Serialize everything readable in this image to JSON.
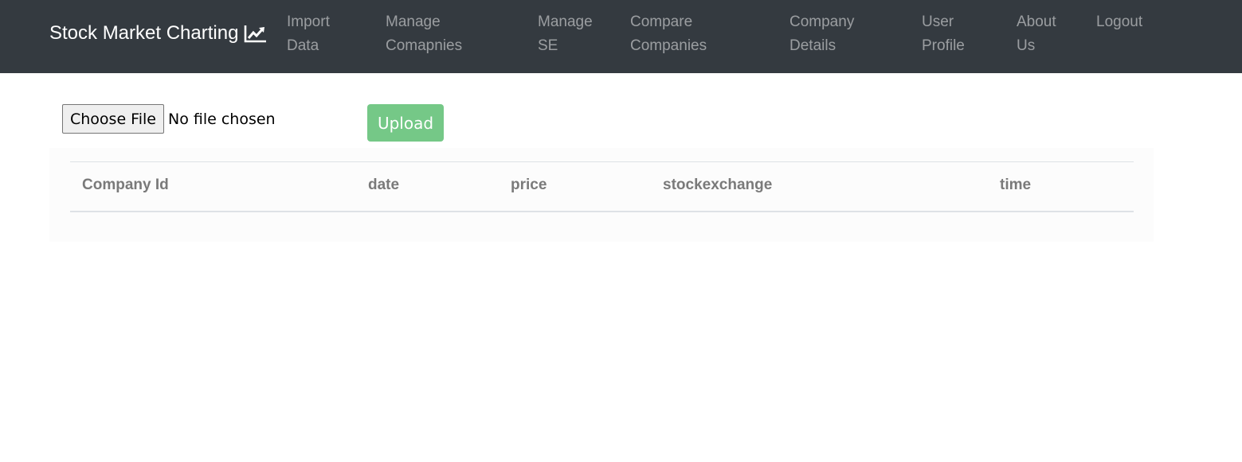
{
  "brand": {
    "title": "Stock Market Charting",
    "icon": "chart-line-icon"
  },
  "nav": {
    "items": [
      {
        "line1": "Import",
        "line2": "Data"
      },
      {
        "line1": "Manage",
        "line2": "Comapnies"
      },
      {
        "line1": "Manage",
        "line2": "SE"
      },
      {
        "line1": "Compare",
        "line2": "Companies"
      },
      {
        "line1": "Company",
        "line2": "Details"
      },
      {
        "line1": "User",
        "line2": "Profile"
      },
      {
        "line1": "About",
        "line2": "Us"
      },
      {
        "line1": "Logout",
        "line2": ""
      }
    ]
  },
  "file_input": {
    "button_label": "Choose File",
    "status": "No file chosen"
  },
  "upload": {
    "label": "Upload"
  },
  "table": {
    "headers": [
      "Company Id",
      "date",
      "price",
      "stockexchange",
      "time"
    ],
    "rows": []
  },
  "colors": {
    "navbar": "#343a40",
    "upload_button": "#75c887"
  }
}
